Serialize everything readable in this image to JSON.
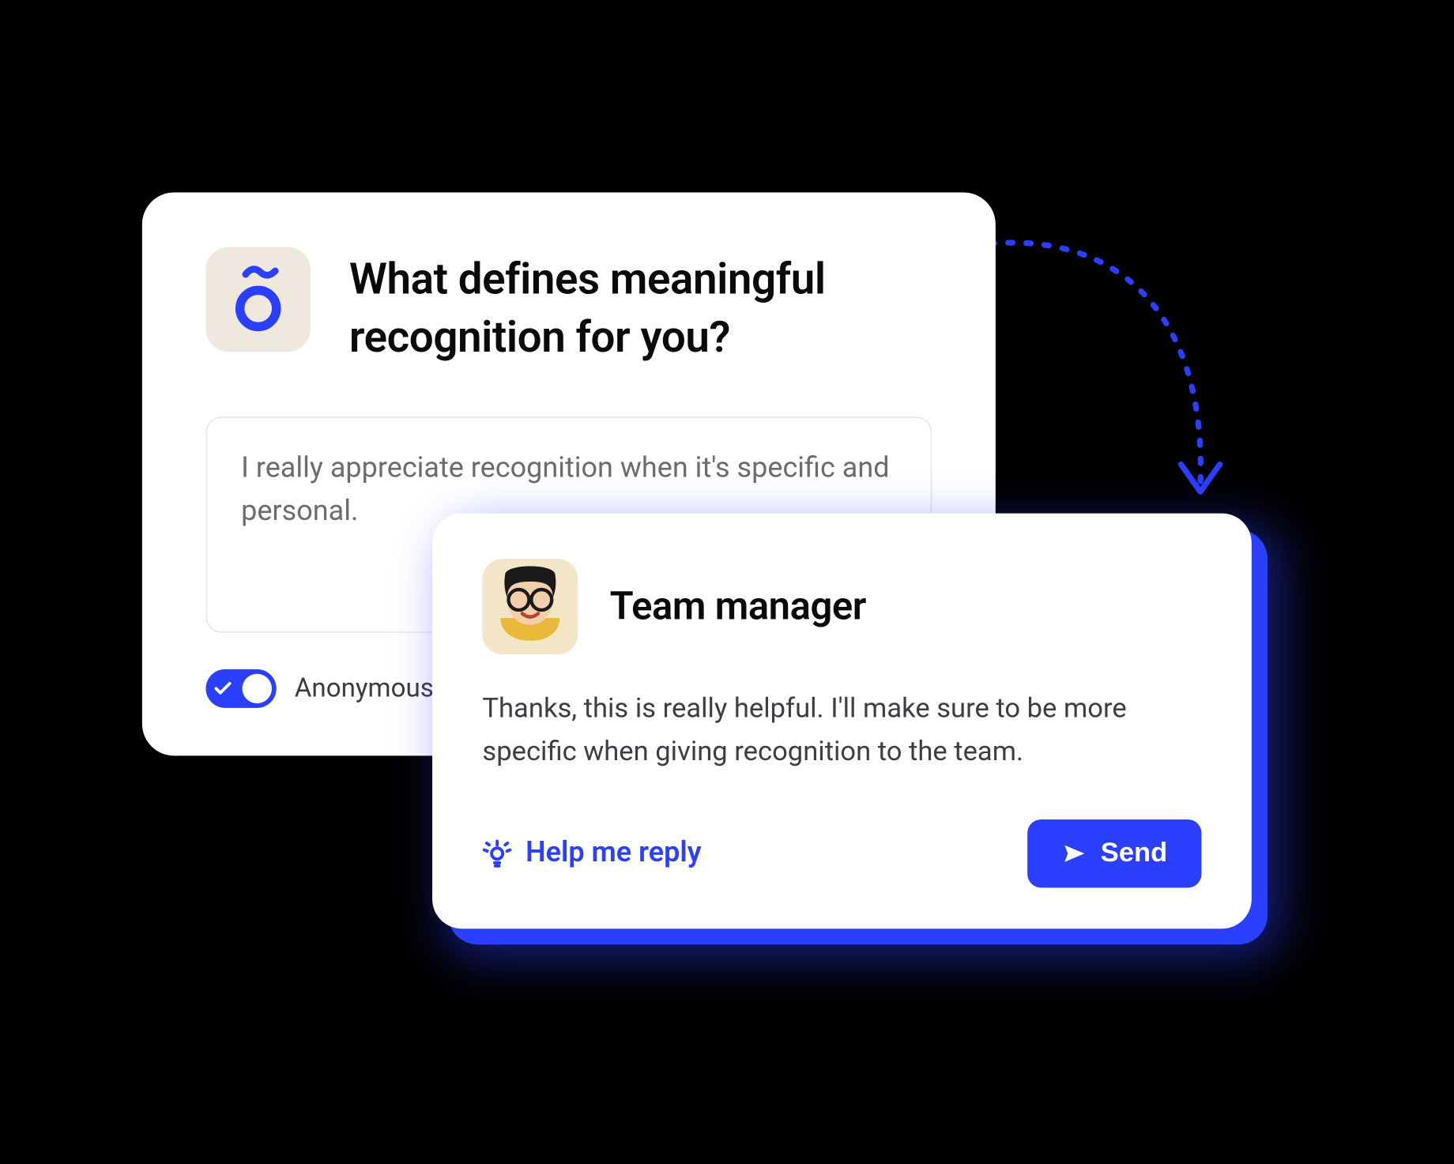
{
  "colors": {
    "accent": "#2a3fff",
    "iconBg": "#efe8df"
  },
  "question": {
    "title": "What defines meaningful recognition for you?",
    "answer": "I really appreciate recognition when it's specific and personal.",
    "toggleLabel": "Anonymous"
  },
  "reply": {
    "role": "Team manager",
    "body": "Thanks, this is really helpful. I'll make sure to be more specific when giving recognition to the team.",
    "helpLabel": "Help me reply",
    "sendLabel": "Send"
  }
}
